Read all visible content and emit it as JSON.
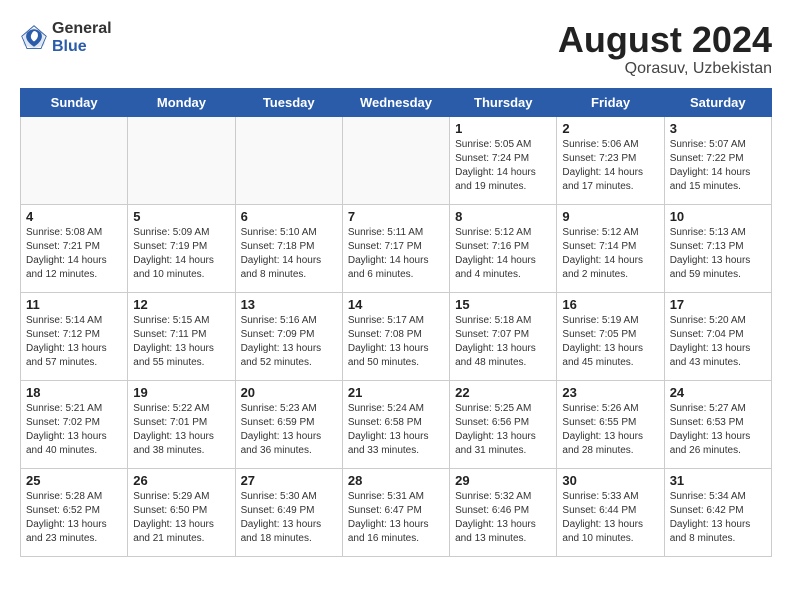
{
  "header": {
    "logo_general": "General",
    "logo_blue": "Blue",
    "month_year": "August 2024",
    "location": "Qorasuv, Uzbekistan"
  },
  "days_of_week": [
    "Sunday",
    "Monday",
    "Tuesday",
    "Wednesday",
    "Thursday",
    "Friday",
    "Saturday"
  ],
  "weeks": [
    [
      {
        "day": "",
        "info": ""
      },
      {
        "day": "",
        "info": ""
      },
      {
        "day": "",
        "info": ""
      },
      {
        "day": "",
        "info": ""
      },
      {
        "day": "1",
        "info": "Sunrise: 5:05 AM\nSunset: 7:24 PM\nDaylight: 14 hours\nand 19 minutes."
      },
      {
        "day": "2",
        "info": "Sunrise: 5:06 AM\nSunset: 7:23 PM\nDaylight: 14 hours\nand 17 minutes."
      },
      {
        "day": "3",
        "info": "Sunrise: 5:07 AM\nSunset: 7:22 PM\nDaylight: 14 hours\nand 15 minutes."
      }
    ],
    [
      {
        "day": "4",
        "info": "Sunrise: 5:08 AM\nSunset: 7:21 PM\nDaylight: 14 hours\nand 12 minutes."
      },
      {
        "day": "5",
        "info": "Sunrise: 5:09 AM\nSunset: 7:19 PM\nDaylight: 14 hours\nand 10 minutes."
      },
      {
        "day": "6",
        "info": "Sunrise: 5:10 AM\nSunset: 7:18 PM\nDaylight: 14 hours\nand 8 minutes."
      },
      {
        "day": "7",
        "info": "Sunrise: 5:11 AM\nSunset: 7:17 PM\nDaylight: 14 hours\nand 6 minutes."
      },
      {
        "day": "8",
        "info": "Sunrise: 5:12 AM\nSunset: 7:16 PM\nDaylight: 14 hours\nand 4 minutes."
      },
      {
        "day": "9",
        "info": "Sunrise: 5:12 AM\nSunset: 7:14 PM\nDaylight: 14 hours\nand 2 minutes."
      },
      {
        "day": "10",
        "info": "Sunrise: 5:13 AM\nSunset: 7:13 PM\nDaylight: 13 hours\nand 59 minutes."
      }
    ],
    [
      {
        "day": "11",
        "info": "Sunrise: 5:14 AM\nSunset: 7:12 PM\nDaylight: 13 hours\nand 57 minutes."
      },
      {
        "day": "12",
        "info": "Sunrise: 5:15 AM\nSunset: 7:11 PM\nDaylight: 13 hours\nand 55 minutes."
      },
      {
        "day": "13",
        "info": "Sunrise: 5:16 AM\nSunset: 7:09 PM\nDaylight: 13 hours\nand 52 minutes."
      },
      {
        "day": "14",
        "info": "Sunrise: 5:17 AM\nSunset: 7:08 PM\nDaylight: 13 hours\nand 50 minutes."
      },
      {
        "day": "15",
        "info": "Sunrise: 5:18 AM\nSunset: 7:07 PM\nDaylight: 13 hours\nand 48 minutes."
      },
      {
        "day": "16",
        "info": "Sunrise: 5:19 AM\nSunset: 7:05 PM\nDaylight: 13 hours\nand 45 minutes."
      },
      {
        "day": "17",
        "info": "Sunrise: 5:20 AM\nSunset: 7:04 PM\nDaylight: 13 hours\nand 43 minutes."
      }
    ],
    [
      {
        "day": "18",
        "info": "Sunrise: 5:21 AM\nSunset: 7:02 PM\nDaylight: 13 hours\nand 40 minutes."
      },
      {
        "day": "19",
        "info": "Sunrise: 5:22 AM\nSunset: 7:01 PM\nDaylight: 13 hours\nand 38 minutes."
      },
      {
        "day": "20",
        "info": "Sunrise: 5:23 AM\nSunset: 6:59 PM\nDaylight: 13 hours\nand 36 minutes."
      },
      {
        "day": "21",
        "info": "Sunrise: 5:24 AM\nSunset: 6:58 PM\nDaylight: 13 hours\nand 33 minutes."
      },
      {
        "day": "22",
        "info": "Sunrise: 5:25 AM\nSunset: 6:56 PM\nDaylight: 13 hours\nand 31 minutes."
      },
      {
        "day": "23",
        "info": "Sunrise: 5:26 AM\nSunset: 6:55 PM\nDaylight: 13 hours\nand 28 minutes."
      },
      {
        "day": "24",
        "info": "Sunrise: 5:27 AM\nSunset: 6:53 PM\nDaylight: 13 hours\nand 26 minutes."
      }
    ],
    [
      {
        "day": "25",
        "info": "Sunrise: 5:28 AM\nSunset: 6:52 PM\nDaylight: 13 hours\nand 23 minutes."
      },
      {
        "day": "26",
        "info": "Sunrise: 5:29 AM\nSunset: 6:50 PM\nDaylight: 13 hours\nand 21 minutes."
      },
      {
        "day": "27",
        "info": "Sunrise: 5:30 AM\nSunset: 6:49 PM\nDaylight: 13 hours\nand 18 minutes."
      },
      {
        "day": "28",
        "info": "Sunrise: 5:31 AM\nSunset: 6:47 PM\nDaylight: 13 hours\nand 16 minutes."
      },
      {
        "day": "29",
        "info": "Sunrise: 5:32 AM\nSunset: 6:46 PM\nDaylight: 13 hours\nand 13 minutes."
      },
      {
        "day": "30",
        "info": "Sunrise: 5:33 AM\nSunset: 6:44 PM\nDaylight: 13 hours\nand 10 minutes."
      },
      {
        "day": "31",
        "info": "Sunrise: 5:34 AM\nSunset: 6:42 PM\nDaylight: 13 hours\nand 8 minutes."
      }
    ]
  ]
}
